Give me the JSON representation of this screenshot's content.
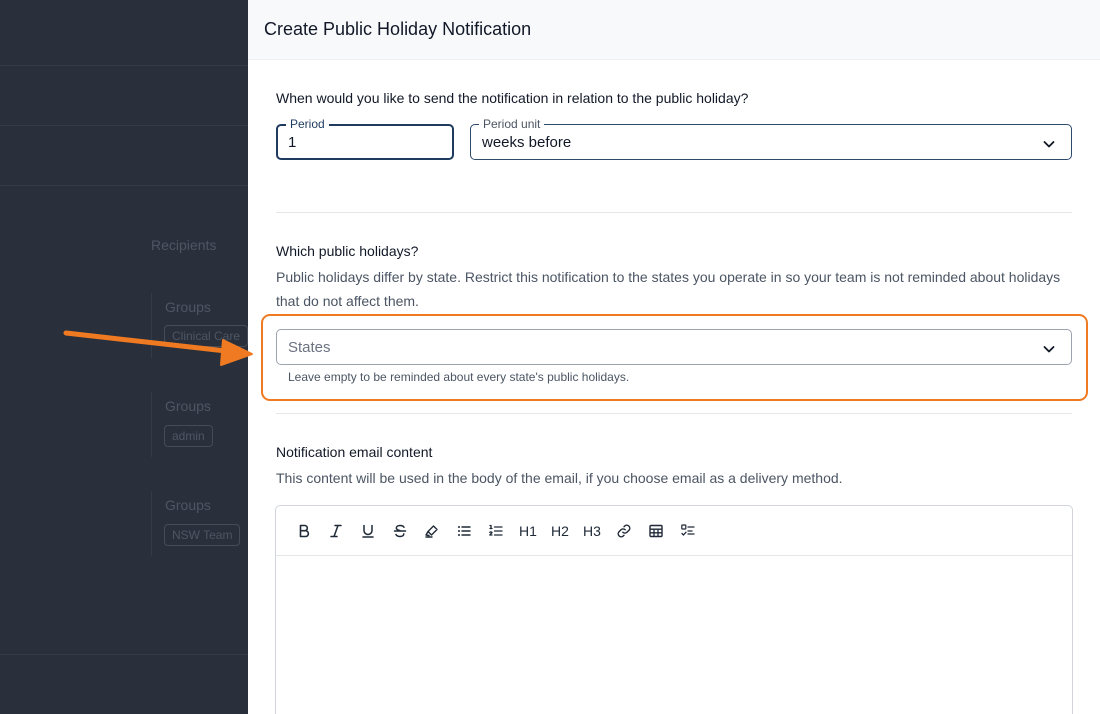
{
  "background": {
    "recipients_label": "Recipients",
    "groups": [
      {
        "label": "Groups",
        "chip": "Clinical Care"
      },
      {
        "label": "Groups",
        "chip": "admin"
      },
      {
        "label": "Groups",
        "chip": "NSW Team"
      }
    ]
  },
  "drawer": {
    "title": "Create Public Holiday Notification",
    "timing": {
      "question": "When would you like to send the notification in relation to the public holiday?",
      "period": {
        "label": "Period",
        "value": "1"
      },
      "period_unit": {
        "label": "Period unit",
        "value": "weeks before"
      }
    },
    "holidays": {
      "question": "Which public holidays?",
      "description": "Public holidays differ by state. Restrict this notification to the states you operate in so your team is not reminded about holidays that do not affect them.",
      "states_placeholder": "States",
      "helper": "Leave empty to be reminded about every state's public holidays."
    },
    "email": {
      "title": "Notification email content",
      "description": "This content will be used in the body of the email, if you choose email as a delivery method.",
      "toolbar": {
        "h1": "H1",
        "h2": "H2",
        "h3": "H3"
      }
    }
  },
  "colors": {
    "highlight": "#f07a22",
    "arrow": "#f07a22",
    "focused_border": "#1e3a5f"
  }
}
